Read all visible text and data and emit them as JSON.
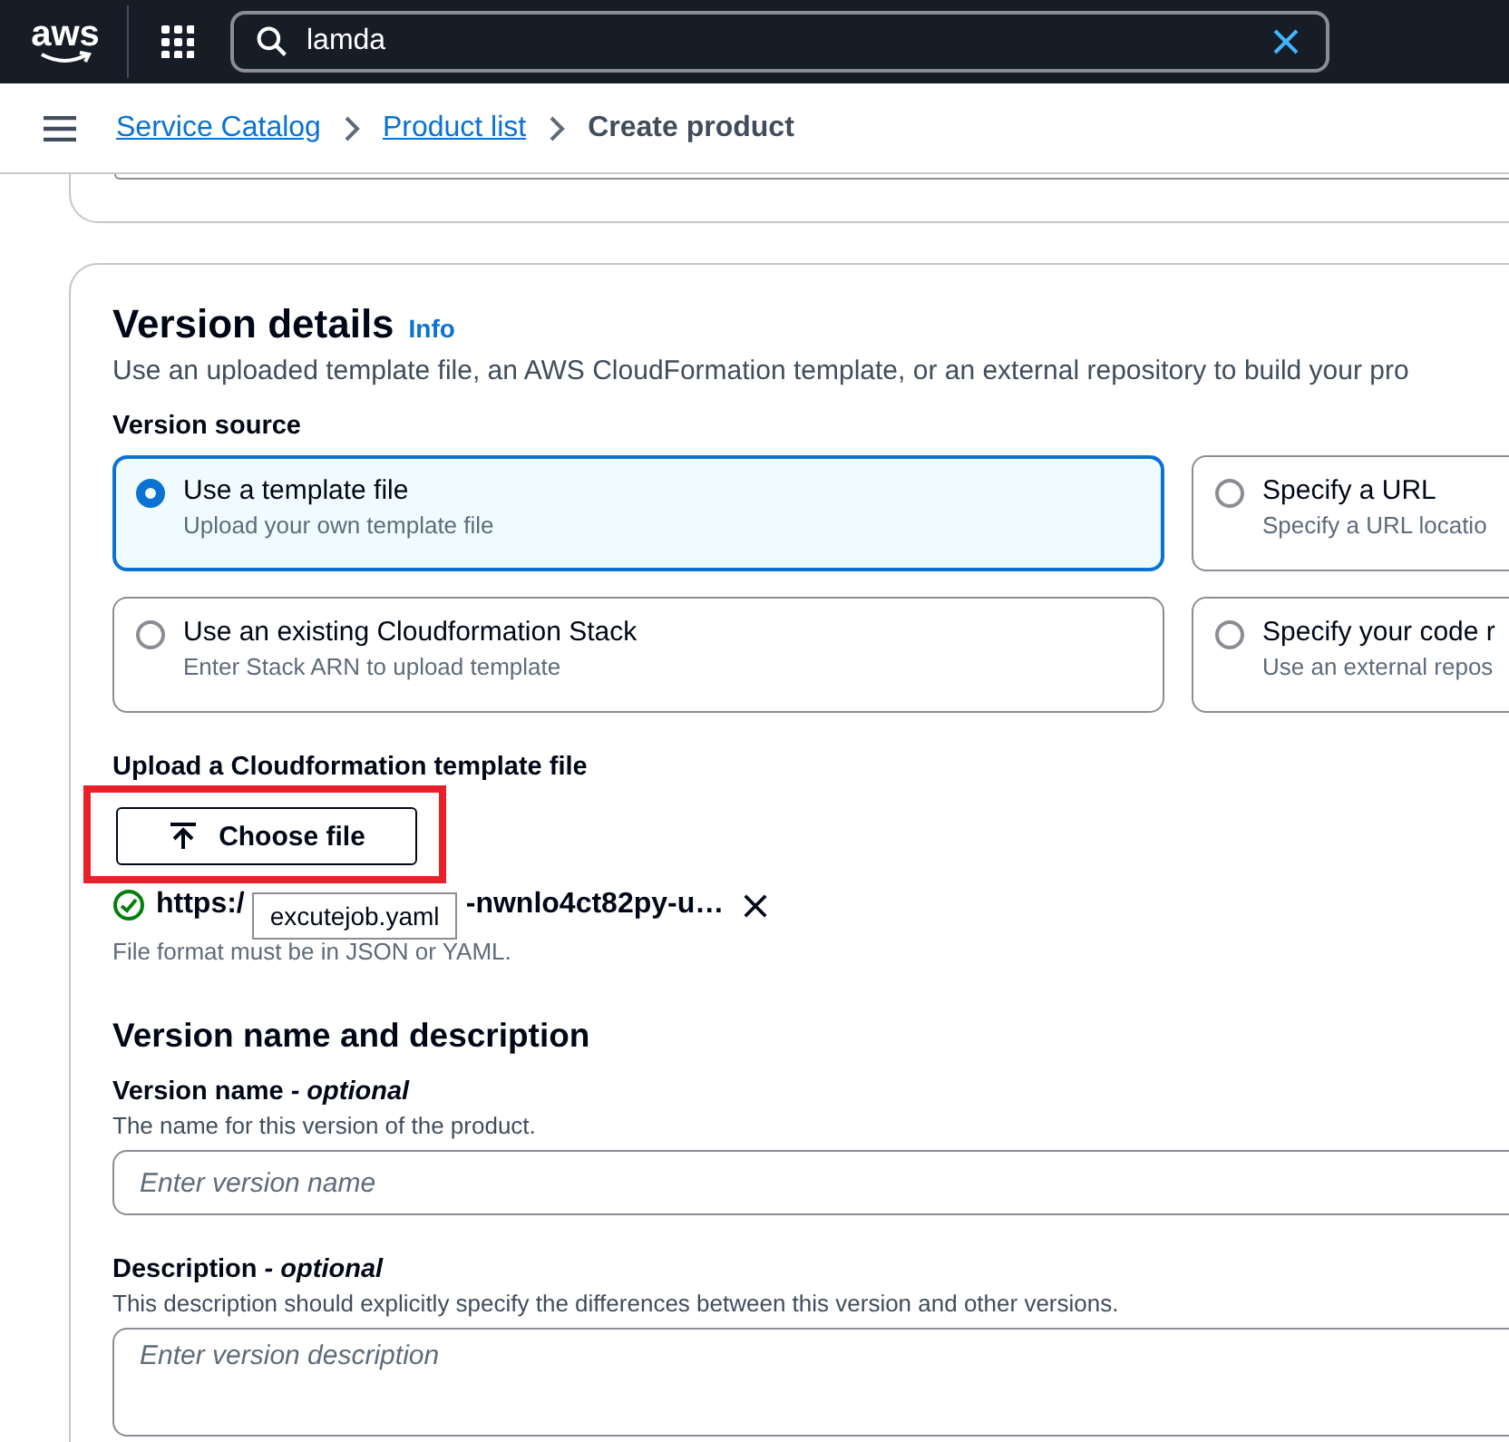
{
  "top_nav": {
    "logo": "aws",
    "search": {
      "value": "lamda"
    }
  },
  "breadcrumbs": [
    {
      "label": "Service Catalog",
      "kind": "link"
    },
    {
      "label": "Product list",
      "kind": "link"
    },
    {
      "label": "Create product",
      "kind": "current"
    }
  ],
  "version_details": {
    "title": "Version details",
    "info": "Info",
    "description": "Use an uploaded template file, an AWS CloudFormation template, or an external repository to build your pro",
    "version_source": {
      "label": "Version source",
      "options": [
        {
          "title": "Use a template file",
          "subtitle": "Upload your own template file",
          "selected": true
        },
        {
          "title": "Specify a URL",
          "subtitle": "Specify a URL locatio",
          "selected": false
        },
        {
          "title": "Use an existing Cloudformation Stack",
          "subtitle": "Enter Stack ARN to upload template",
          "selected": false
        },
        {
          "title": "Specify your code r",
          "subtitle": "Use an external repos",
          "selected": false
        }
      ]
    },
    "upload": {
      "label": "Upload a Cloudformation template file",
      "button": "Choose file",
      "highlighted": true,
      "file_start": "https:/",
      "file_end": "-nwnlo4ct82py-u…",
      "tooltip": "excutejob.yaml",
      "hint": "File format must be in JSON or YAML."
    },
    "name_section": {
      "title": "Version name and description",
      "fields": [
        {
          "label": "Version name",
          "optional": "- optional",
          "help": "The name for this version of the product.",
          "placeholder": "Enter version name",
          "kind": "input"
        },
        {
          "label": "Description",
          "optional": "- optional",
          "help": "This description should explicitly specify the differences between this version and other versions.",
          "placeholder": "Enter version description",
          "kind": "textarea"
        }
      ]
    }
  }
}
